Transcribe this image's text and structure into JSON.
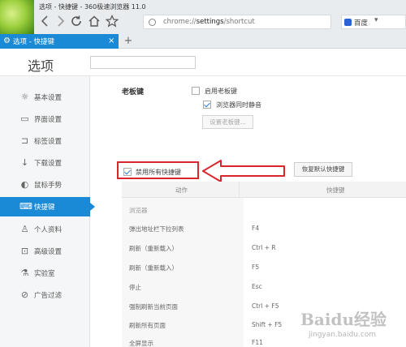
{
  "window": {
    "title": "选项 - 快捷键 - 360极速浏览器 11.0"
  },
  "toolbar": {
    "back_icon": "arrow-left-icon",
    "forward_icon": "arrow-right-icon",
    "reload_icon": "reload-icon",
    "home_icon": "home-icon",
    "star_icon": "star-icon",
    "address": {
      "prefix": "chrome://",
      "bold": "settings",
      "suffix": "/shortcut"
    },
    "search_engine": "百度"
  },
  "tabs": [
    {
      "label": "选项 - 快捷键",
      "active": true
    }
  ],
  "header": {
    "title": "选项",
    "search_placeholder": ""
  },
  "sidebar": {
    "items": [
      {
        "label": "基本设置",
        "icon": "gear-icon"
      },
      {
        "label": "界面设置",
        "icon": "window-icon"
      },
      {
        "label": "标签设置",
        "icon": "tab-icon"
      },
      {
        "label": "下载设置",
        "icon": "download-icon"
      },
      {
        "label": "鼠标手势",
        "icon": "mouse-icon"
      },
      {
        "label": "快捷键",
        "icon": "keyboard-icon",
        "active": true
      },
      {
        "label": "个人资料",
        "icon": "user-icon"
      },
      {
        "label": "高级设置",
        "icon": "advanced-icon"
      },
      {
        "label": "实验室",
        "icon": "lab-icon"
      },
      {
        "label": "广告过滤",
        "icon": "block-icon"
      }
    ]
  },
  "boss_key": {
    "title": "老板键",
    "enable_label": "启用老板键",
    "enable_checked": false,
    "mute_label": "浏览器同时静音",
    "mute_checked": true,
    "set_button": "设置老板键..."
  },
  "shortcuts": {
    "disable_all_label": "禁用所有快捷键",
    "disable_all_checked": true,
    "restore_button": "恢复默认快捷键",
    "columns": [
      "动作",
      "快捷键"
    ],
    "section": "浏览器",
    "rows": [
      {
        "action": "弹出地址栏下拉列表",
        "key": "F4"
      },
      {
        "action": "刷新（重新载入）",
        "key": "Ctrl + R"
      },
      {
        "action": "刷新（重新载入）",
        "key": "F5"
      },
      {
        "action": "停止",
        "key": "Esc"
      },
      {
        "action": "强制刷新当前页面",
        "key": "Ctrl + F5"
      },
      {
        "action": "刷新所有页面",
        "key": "Shift + F5"
      },
      {
        "action": "全屏显示",
        "key": "F11"
      }
    ]
  },
  "watermark": {
    "main": "Baidu经验",
    "sub": "jingyan.baidu.com"
  },
  "colors": {
    "accent": "#1a8ad6",
    "highlight_box": "#d9262d"
  }
}
